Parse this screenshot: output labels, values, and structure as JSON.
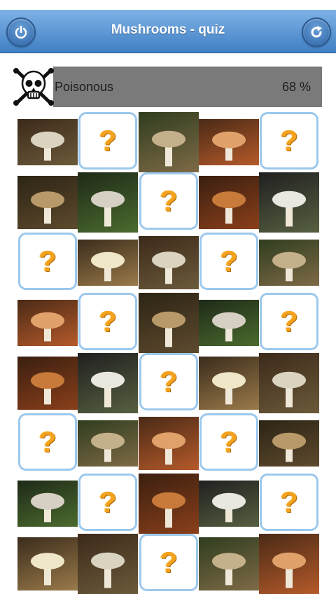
{
  "header": {
    "title": "Mushrooms - quiz",
    "left_button": "power-icon",
    "right_button": "refresh-icon"
  },
  "progress": {
    "label": "Poisonous",
    "percent_text": "68 %",
    "value": 0.68
  },
  "grid": {
    "hidden_symbol": "?",
    "cells": [
      [
        "photo",
        "hidden",
        "photo",
        "photo",
        "hidden"
      ],
      [
        "photo",
        "photo",
        "hidden",
        "photo",
        "photo"
      ],
      [
        "hidden",
        "photo",
        "photo",
        "hidden",
        "photo"
      ],
      [
        "photo",
        "hidden",
        "photo",
        "photo",
        "hidden"
      ],
      [
        "photo",
        "photo",
        "hidden",
        "photo",
        "photo"
      ],
      [
        "hidden",
        "photo",
        "photo",
        "hidden",
        "photo"
      ],
      [
        "photo",
        "hidden",
        "photo",
        "photo",
        "hidden"
      ],
      [
        "photo",
        "photo",
        "hidden",
        "photo",
        "photo"
      ]
    ]
  },
  "colors": {
    "header_top": "#7fb2e6",
    "header_bottom": "#3f7fc4",
    "card_border": "#9cc8ec",
    "question_mark": "#f3a21f",
    "progress_bar": "#7a7a7a"
  }
}
